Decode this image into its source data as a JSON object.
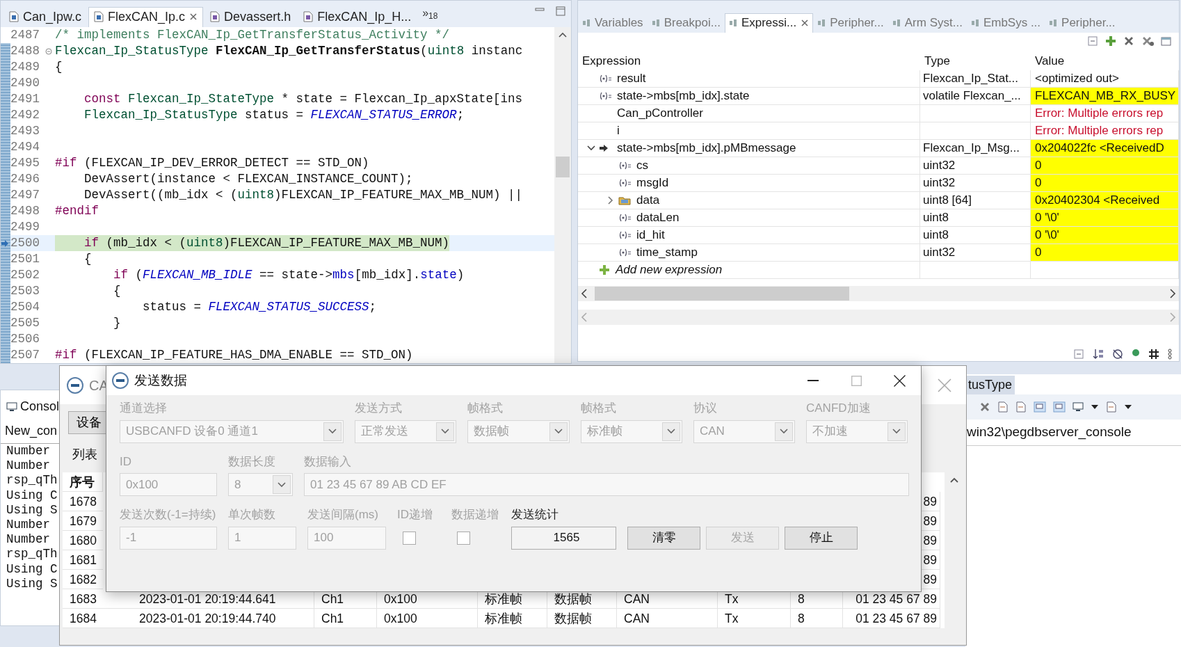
{
  "editor": {
    "tabs": [
      {
        "label": "Can_Ipw.c",
        "kind": "c",
        "selected": false,
        "closable": false
      },
      {
        "label": "FlexCAN_Ip.c",
        "kind": "c",
        "selected": true,
        "closable": true
      },
      {
        "label": "Devassert.h",
        "kind": "h",
        "selected": false,
        "closable": false
      },
      {
        "label": "FlexCAN_Ip_H...",
        "kind": "h",
        "selected": false,
        "closable": false
      }
    ],
    "overflow": "»$_{18}$",
    "lines": [
      {
        "number": "2487",
        "current": false,
        "tokens": [
          {
            "text": "/* implements FlexCAN_Ip_GetTransferStatus_Activity */",
            "kind": "comment"
          }
        ]
      },
      {
        "number": "2488",
        "fold": true,
        "current": false,
        "tokens": [
          {
            "text": "Flexcan_Ip_StatusType",
            "kind": "type"
          },
          {
            "text": " FlexCAN_Ip_GetTransferStatus",
            "kind": "bold"
          },
          {
            "text": "(",
            "kind": "plain"
          },
          {
            "text": "uint8",
            "kind": "type"
          },
          {
            "text": " instanc",
            "kind": "plain"
          }
        ]
      },
      {
        "number": "2489",
        "current": false,
        "tokens": [
          {
            "text": "{",
            "kind": "plain"
          }
        ]
      },
      {
        "number": "2490",
        "current": false
      },
      {
        "number": "2491",
        "current": false,
        "tokens": [
          {
            "text": "    const",
            "kind": "keyword"
          },
          {
            "text": " Flexcan_Ip_StateType",
            "kind": "type"
          },
          {
            "text": " * state = Flexcan_Ip_apxState[ins",
            "kind": "plain"
          }
        ]
      },
      {
        "number": "2492",
        "current": false,
        "tokens": [
          {
            "text": "    Flexcan_Ip_StatusType",
            "kind": "type"
          },
          {
            "text": " status = ",
            "kind": "plain"
          },
          {
            "text": "FLEXCAN_STATUS_ERROR",
            "kind": "enum"
          },
          {
            "text": ";",
            "kind": "plain"
          }
        ]
      },
      {
        "number": "2493",
        "current": false
      },
      {
        "number": "2494",
        "current": false
      },
      {
        "number": "2495",
        "current": false,
        "tokens": [
          {
            "text": "#if",
            "kind": "keyword"
          },
          {
            "text": " (FLEXCAN_IP_DEV_ERROR_DETECT == STD_ON)",
            "kind": "plain"
          }
        ]
      },
      {
        "number": "2496",
        "current": false,
        "tokens": [
          {
            "text": "    DevAssert(instance < FLEXCAN_INSTANCE_COUNT);",
            "kind": "plain"
          }
        ]
      },
      {
        "number": "2497",
        "current": false,
        "tokens": [
          {
            "text": "    DevAssert((mb_idx < (",
            "kind": "plain"
          },
          {
            "text": "uint8",
            "kind": "type"
          },
          {
            "text": ")FLEXCAN_IP_FEATURE_MAX_MB_NUM) ||",
            "kind": "plain"
          }
        ]
      },
      {
        "number": "2498",
        "current": false,
        "tokens": [
          {
            "text": "#endif",
            "kind": "keyword"
          }
        ]
      },
      {
        "number": "2499",
        "current": false
      },
      {
        "number": "2500",
        "current": true,
        "tokens": [
          {
            "text": "    if",
            "kind": "keyword"
          },
          {
            "text": " (mb_idx < (",
            "kind": "plain"
          },
          {
            "text": "uint8",
            "kind": "type"
          },
          {
            "text": ")FLEXCAN_IP_FEATURE_MAX_MB_NUM)",
            "kind": "plain"
          }
        ]
      },
      {
        "number": "2501",
        "current": false,
        "tokens": [
          {
            "text": "    {",
            "kind": "plain"
          }
        ]
      },
      {
        "number": "2502",
        "current": false,
        "tokens": [
          {
            "text": "        if",
            "kind": "keyword"
          },
          {
            "text": " (",
            "kind": "plain"
          },
          {
            "text": "FLEXCAN_MB_IDLE",
            "kind": "enum"
          },
          {
            "text": " == state->",
            "kind": "plain"
          },
          {
            "text": "mbs",
            "kind": "field"
          },
          {
            "text": "[mb_idx].",
            "kind": "plain"
          },
          {
            "text": "state",
            "kind": "field"
          },
          {
            "text": ")",
            "kind": "plain"
          }
        ]
      },
      {
        "number": "2503",
        "current": false,
        "tokens": [
          {
            "text": "        {",
            "kind": "plain"
          }
        ]
      },
      {
        "number": "2504",
        "current": false,
        "tokens": [
          {
            "text": "            status = ",
            "kind": "plain"
          },
          {
            "text": "FLEXCAN_STATUS_SUCCESS",
            "kind": "enum"
          },
          {
            "text": ";",
            "kind": "plain"
          }
        ]
      },
      {
        "number": "2505",
        "current": false,
        "tokens": [
          {
            "text": "        }",
            "kind": "plain"
          }
        ]
      },
      {
        "number": "2506",
        "current": false
      },
      {
        "number": "2507",
        "current": false,
        "tokens": [
          {
            "text": "#if",
            "kind": "keyword"
          },
          {
            "text": " (FLEXCAN_IP_FEATURE_HAS_DMA_ENABLE == STD_ON)",
            "kind": "plain"
          }
        ]
      }
    ]
  },
  "expressions_view": {
    "tabs": [
      {
        "label": "Variables",
        "selected": false,
        "closable": false
      },
      {
        "label": "Breakpoi...",
        "selected": false,
        "closable": false
      },
      {
        "label": "Expressi...",
        "selected": true,
        "closable": true
      },
      {
        "label": "Peripher...",
        "selected": false,
        "closable": false
      },
      {
        "label": "Arm Syst...",
        "selected": false,
        "closable": false
      },
      {
        "label": "EmbSys ...",
        "selected": false,
        "closable": false
      },
      {
        "label": "Peripher...",
        "selected": false,
        "closable": false
      }
    ],
    "columns": [
      "Expression",
      "Type",
      "Value"
    ],
    "rows": [
      {
        "expression": "result",
        "kind": "variable",
        "type": "Flexcan_Ip_Stat...",
        "value": "<optimized out>",
        "changed": false,
        "error": false
      },
      {
        "expression": "state->mbs[mb_idx].state",
        "kind": "variable",
        "type": "volatile Flexcan_...",
        "value": "FLEXCAN_MB_RX_BUSY",
        "changed": true,
        "error": false
      },
      {
        "expression": "Can_pController",
        "kind": "plain",
        "value": "Error: Multiple errors rep",
        "changed": false,
        "error": true
      },
      {
        "expression": "i",
        "kind": "plain",
        "value": "Error: Multiple errors rep",
        "changed": false,
        "error": true
      },
      {
        "expression": "state->mbs[mb_idx].pMBmessage",
        "kind": "pointer",
        "expanded": true,
        "type": "Flexcan_Ip_Msg...",
        "value": "0x204022fc <ReceivedD",
        "changed": true,
        "error": false,
        "children": [
          {
            "expression": "cs",
            "kind": "variable",
            "type": "uint32",
            "value": "0",
            "changed": true,
            "error": false
          },
          {
            "expression": "msgId",
            "kind": "variable",
            "type": "uint32",
            "value": "0",
            "changed": true,
            "error": false
          },
          {
            "expression": "data",
            "kind": "array",
            "expanded": false,
            "type": "uint8 [64]",
            "value": "0x20402304 <Received",
            "changed": true,
            "error": false
          },
          {
            "expression": "dataLen",
            "kind": "variable",
            "type": "uint8",
            "value": "0 '\\0'",
            "changed": true,
            "error": false
          },
          {
            "expression": "id_hit",
            "kind": "variable",
            "type": "uint8",
            "value": "0 '\\0'",
            "changed": true,
            "error": false
          },
          {
            "expression": "time_stamp",
            "kind": "variable",
            "type": "uint32",
            "value": "0",
            "changed": true,
            "error": false
          }
        ]
      }
    ],
    "add_row": "Add new expression"
  },
  "console": {
    "tab": "Consol",
    "session": "New_con",
    "lines": [
      "Number",
      "Number",
      "rsp_qTh",
      "Using C",
      "Using S",
      "Number",
      "Number",
      "rsp_qTh",
      "Using C",
      "Using S"
    ]
  },
  "right_console": {
    "tab": "tusType",
    "path": "win32\\pegdbserver_console"
  },
  "can_window": {
    "title": "CA",
    "device_button": "设备",
    "list_tab": "列表",
    "columns": [
      "序号"
    ],
    "rows": [
      {
        "number": "1678",
        "data": "89"
      },
      {
        "number": "1679",
        "data": "89"
      },
      {
        "number": "1680",
        "data": "89"
      },
      {
        "number": "1681",
        "data": "89"
      },
      {
        "number": "1682",
        "data": "89"
      },
      {
        "number": "1683",
        "time": "2023-01-01 20:19:44.641",
        "channel": "Ch1",
        "id": "0x100",
        "frame_type": "标准帧",
        "frame_format": "数据帧",
        "protocol": "CAN",
        "direction": "Tx",
        "length": "8",
        "data": "01 23 45 67 89"
      },
      {
        "number": "1684",
        "time": "2023-01-01 20:19:44.740",
        "channel": "Ch1",
        "id": "0x100",
        "frame_type": "标准帧",
        "frame_format": "数据帧",
        "protocol": "CAN",
        "direction": "Tx",
        "length": "8",
        "data": "01 23 45 67 89"
      }
    ]
  },
  "send_dialog": {
    "title": "发送数据",
    "rows": [
      {
        "fields": [
          {
            "label": "通道选择",
            "kind": "select",
            "value": "USBCANFD 设备0 通道1",
            "disabled": true
          },
          {
            "label": "发送方式",
            "kind": "select",
            "value": "正常发送",
            "disabled": true
          },
          {
            "label": "帧格式",
            "kind": "select",
            "value": "数据帧",
            "disabled": true
          },
          {
            "label": "帧格式",
            "kind": "select",
            "value": "标准帧",
            "disabled": true
          },
          {
            "label": "协议",
            "kind": "select",
            "value": "CAN",
            "disabled": true
          },
          {
            "label": "CANFD加速",
            "kind": "select",
            "value": "不加速",
            "disabled": true
          }
        ]
      },
      {
        "fields": [
          {
            "label": "ID",
            "kind": "input",
            "value": "0x100",
            "disabled": true
          },
          {
            "label": "数据长度",
            "kind": "select",
            "value": "8",
            "disabled": true
          },
          {
            "label": "数据输入",
            "kind": "input",
            "value": "01 23 45 67 89 AB CD EF",
            "disabled": true
          }
        ]
      },
      {
        "fields": [
          {
            "label": "发送次数(-1=持续)",
            "kind": "input",
            "value": "-1",
            "disabled": true
          },
          {
            "label": "单次帧数",
            "kind": "input",
            "value": "1",
            "disabled": true
          },
          {
            "label": "发送间隔(ms)",
            "kind": "input",
            "value": "100",
            "disabled": true
          },
          {
            "label": "ID递增",
            "kind": "checkbox",
            "checked": false,
            "disabled": true
          },
          {
            "label": "数据递增",
            "kind": "checkbox",
            "checked": false,
            "disabled": true
          },
          {
            "label": "发送统计",
            "kind": "counter",
            "value": "1565",
            "disabled": false
          }
        ]
      }
    ],
    "buttons": [
      {
        "label": "清零",
        "disabled": false
      },
      {
        "label": "发送",
        "disabled": true
      },
      {
        "label": "停止",
        "disabled": false
      }
    ]
  }
}
